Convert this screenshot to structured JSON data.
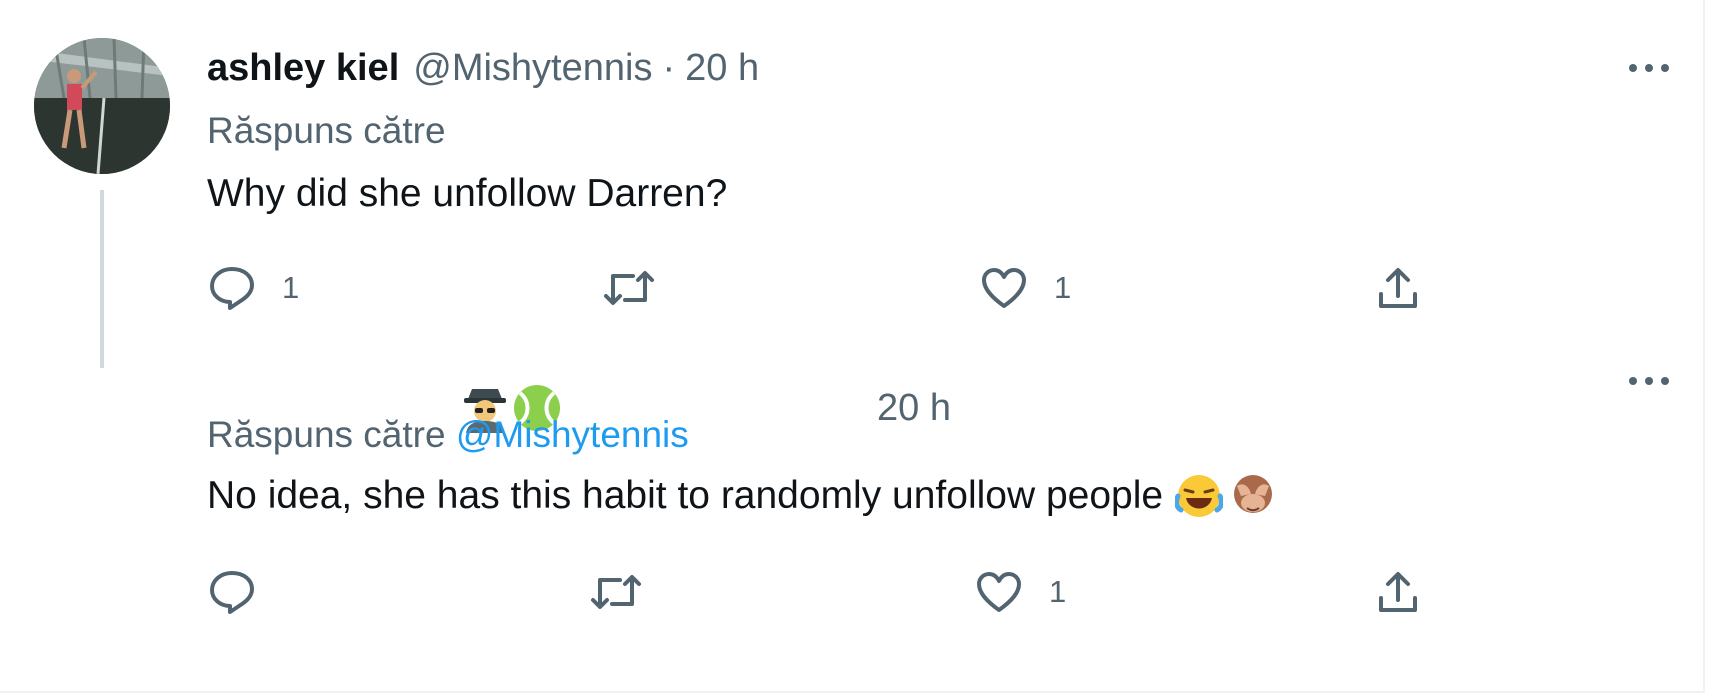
{
  "tweets": [
    {
      "author_name": "ashley kiel",
      "handle": "@Mishytennis",
      "separator": "·",
      "time": "20 h",
      "replying_prefix": "Răspuns către",
      "replying_mention": "",
      "text": "Why did she unfollow Darren?",
      "reply_count": "1",
      "retweet_count": "",
      "like_count": "1",
      "icons": [
        "avatar",
        "more-icon",
        "reply-icon",
        "retweet-icon",
        "like-icon",
        "share-icon"
      ]
    },
    {
      "author_emojis": "🕵️🎾",
      "time": "20 h",
      "replying_prefix": "Răspuns către",
      "replying_mention": "@Mishytennis",
      "text": "No idea, she has this habit to randomly unfollow people",
      "text_emojis": "😂🙈",
      "reply_count": "",
      "retweet_count": "",
      "like_count": "1",
      "icons": [
        "more-icon",
        "reply-icon",
        "retweet-icon",
        "like-icon",
        "share-icon"
      ]
    }
  ],
  "colors": {
    "text_primary": "#0f1419",
    "text_secondary": "#536471",
    "mention": "#1d9bf0",
    "thread_line": "#cfd9de"
  }
}
